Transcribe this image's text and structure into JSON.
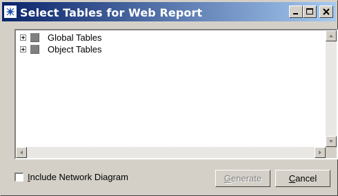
{
  "window": {
    "title": "Select Tables for Web Report",
    "controls": {
      "minimize": "minimize-icon",
      "maximize": "maximize-icon",
      "close": "close-icon"
    },
    "title_gradient": [
      "#0a246a",
      "#a6caf0"
    ]
  },
  "tree": {
    "items": [
      {
        "label": "Global Tables",
        "expanded": false
      },
      {
        "label": "Object Tables",
        "expanded": false
      }
    ]
  },
  "options": {
    "include_network_diagram": {
      "label": "Include Network Diagram",
      "checked": false
    }
  },
  "buttons": {
    "generate": {
      "label": "Generate",
      "enabled": false
    },
    "cancel": {
      "label": "Cancel",
      "enabled": true
    }
  }
}
